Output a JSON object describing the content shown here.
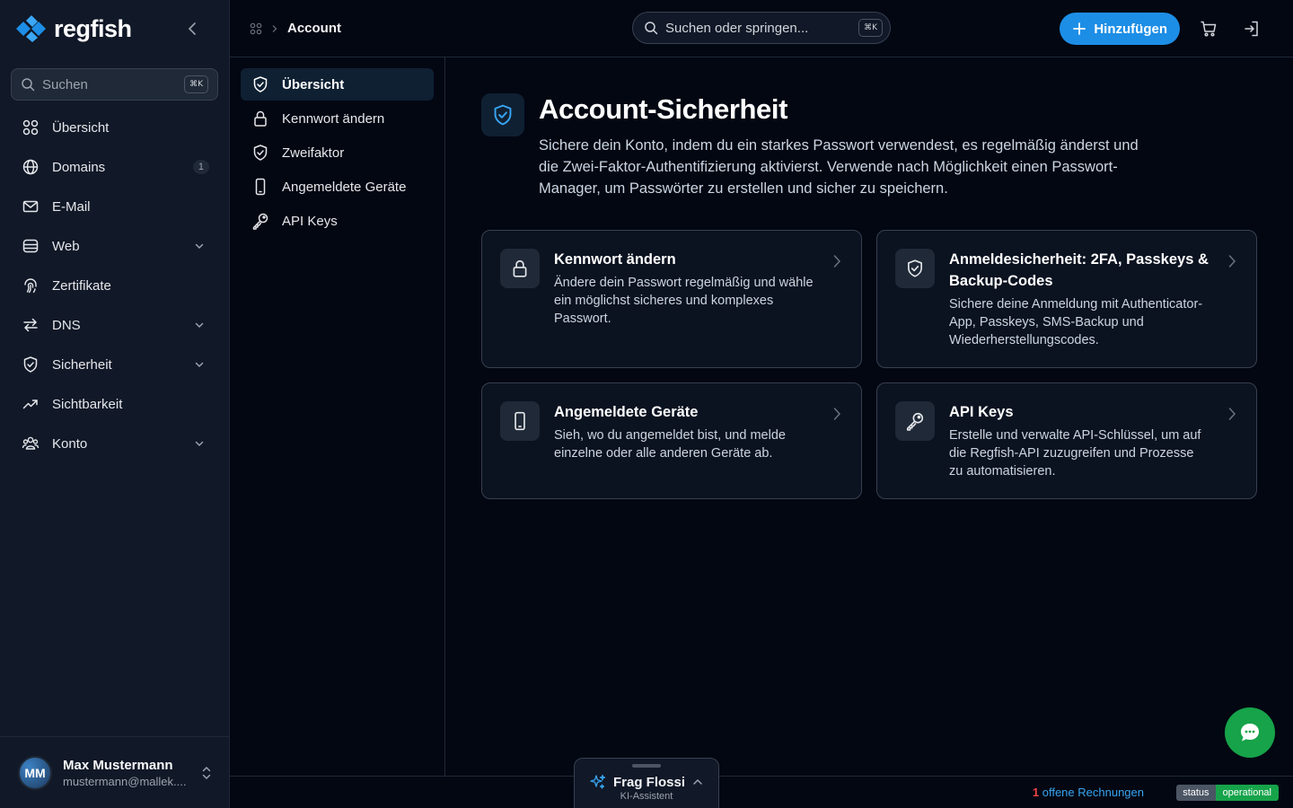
{
  "brand": {
    "name": "regfish",
    "accent": "#1d8ee6"
  },
  "sidebar": {
    "search": {
      "placeholder": "Suchen",
      "shortcut": "⌘K"
    },
    "items": [
      {
        "label": "Übersicht",
        "icon": "grid-icon"
      },
      {
        "label": "Domains",
        "icon": "globe-icon",
        "badge": "1"
      },
      {
        "label": "E-Mail",
        "icon": "mail-icon"
      },
      {
        "label": "Web",
        "icon": "server-icon",
        "expandable": true
      },
      {
        "label": "Zertifikate",
        "icon": "fingerprint-icon"
      },
      {
        "label": "DNS",
        "icon": "arrows-icon",
        "expandable": true
      },
      {
        "label": "Sicherheit",
        "icon": "shield-icon",
        "expandable": true
      },
      {
        "label": "Sichtbarkeit",
        "icon": "trend-icon"
      },
      {
        "label": "Konto",
        "icon": "users-icon",
        "expandable": true
      }
    ],
    "user": {
      "initials": "MM",
      "name": "Max Mustermann",
      "email": "mustermann@mallek...."
    }
  },
  "topbar": {
    "breadcrumb": {
      "current": "Account"
    },
    "search": {
      "placeholder": "Suchen oder springen...",
      "shortcut": "⌘K"
    },
    "add_label": "Hinzufügen"
  },
  "subnav": {
    "items": [
      {
        "label": "Übersicht",
        "icon": "shield-check-icon",
        "active": true
      },
      {
        "label": "Kennwort ändern",
        "icon": "lock-icon"
      },
      {
        "label": "Zweifaktor",
        "icon": "shield-check-icon"
      },
      {
        "label": "Angemeldete Geräte",
        "icon": "phone-icon"
      },
      {
        "label": "API Keys",
        "icon": "key-icon"
      }
    ]
  },
  "main": {
    "title": "Account-Sicherheit",
    "description": "Sichere dein Konto, indem du ein starkes Passwort verwendest, es regelmäßig änderst und die Zwei-Faktor-Authentifizierung aktivierst. Verwende nach Möglichkeit einen Passwort-Manager, um Passwörter zu erstellen und sicher zu speichern.",
    "cards": [
      {
        "title": "Kennwort ändern",
        "description": "Ändere dein Passwort regelmäßig und wähle ein möglichst sicheres und komplexes Passwort.",
        "icon": "lock-icon"
      },
      {
        "title": "Anmeldesicherheit: 2FA, Passkeys & Backup-Codes",
        "description": "Sichere deine Anmeldung mit Authenticator-App, Passkeys, SMS-Backup und Wiederherstellungscodes.",
        "icon": "shield-check-icon"
      },
      {
        "title": "Angemeldete Geräte",
        "description": "Sieh, wo du angemeldet bist, und melde einzelne oder alle anderen Geräte ab.",
        "icon": "phone-icon"
      },
      {
        "title": "API Keys",
        "description": "Erstelle und verwalte API-Schlüssel, um auf die Regfish-API zuzugreifen und Prozesse zu automatisieren.",
        "icon": "key-icon"
      }
    ]
  },
  "footer": {
    "invoices_count": "1",
    "invoices_label": " offene Rechnungen",
    "status_key": "status",
    "status_value": "operational"
  },
  "assistant": {
    "name": "Frag Flossi",
    "subtitle": "KI-Assistent"
  }
}
